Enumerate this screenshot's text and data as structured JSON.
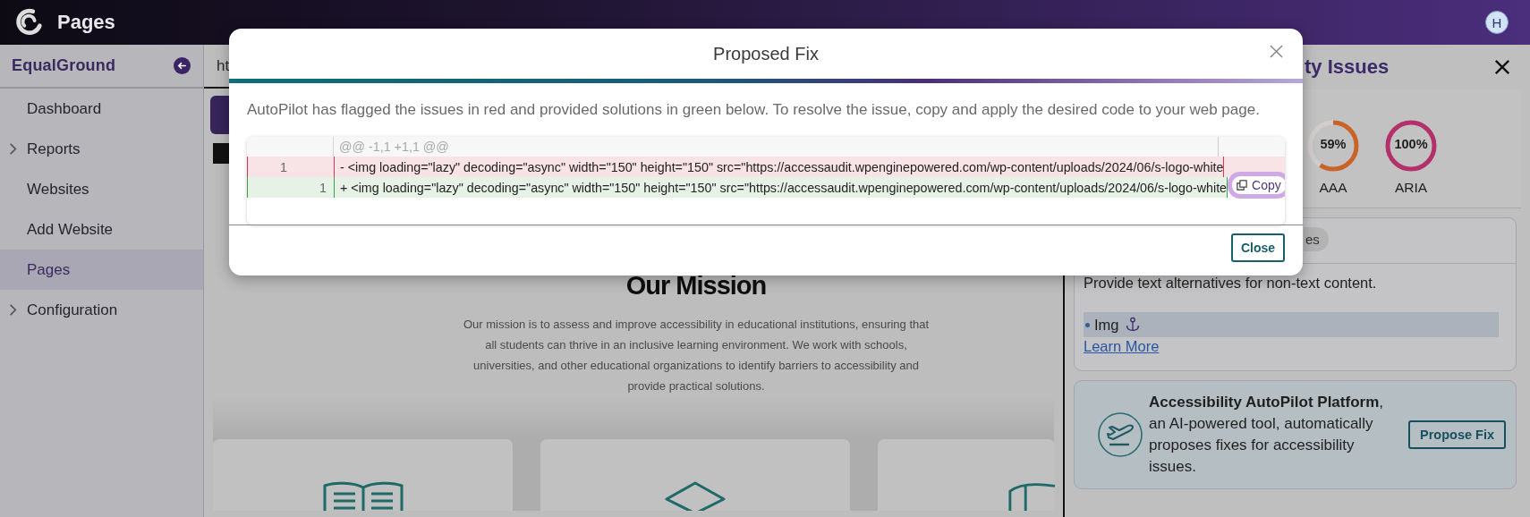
{
  "header": {
    "title": "Pages",
    "avatar": "H"
  },
  "sidebar": {
    "brand": "EqualGround",
    "items": [
      {
        "label": "Dashboard",
        "kind": "link",
        "selected": false
      },
      {
        "label": "Reports",
        "kind": "group",
        "expanded": false,
        "selected": false
      },
      {
        "label": "Websites",
        "kind": "link",
        "selected": false
      },
      {
        "label": "Add Website",
        "kind": "link",
        "selected": false
      },
      {
        "label": "Pages",
        "kind": "link",
        "selected": true
      },
      {
        "label": "Configuration",
        "kind": "group",
        "expanded": false,
        "selected": false
      }
    ]
  },
  "main": {
    "tab": "ht",
    "mission": {
      "heading": "Our Mission",
      "text": "Our mission is to assess and improve accessibility in educational institutions, ensuring that all students can thrive in an inclusive learning environment. We work with schools, universities, and other educational organizations to identify barriers to accessibility and provide practical solutions."
    }
  },
  "issues_panel": {
    "title": "ty Issues",
    "gauges": [
      {
        "value": "59%",
        "label": "AAA",
        "color": "#c8632a"
      },
      {
        "value": "100%",
        "label": "ARIA",
        "color": "#b3306b"
      }
    ],
    "tab": "es",
    "guideline": "Provide text alternatives for non-text content.",
    "elements": [
      {
        "label": "Img",
        "selected": true
      }
    ],
    "link": "Learn More",
    "autopilot": {
      "text": "**Accessibility AutoPilot Platform**, an AI-powered tool, automatically proposes fixes for accessibility issues.",
      "button": "Propose Fix"
    }
  },
  "modal": {
    "title": "Proposed Fix",
    "description": "AutoPilot has flagged the issues in red and provided solutions in green below. To resolve the issue, copy and apply the desired code to your web page.",
    "diff": {
      "hunk": "@@ -1,1 +1,1 @@",
      "lines": [
        {
          "kind": "removed",
          "old_line": "1",
          "text": "- <img loading=\"lazy\" decoding=\"async\" width=\"150\" height=\"150\" src=\"https://accessaudit.wpenginepowered.com/wp-content/uploads/2024/06/s-logo-white"
        },
        {
          "kind": "added",
          "new_line": "1",
          "text": "+ <img loading=\"lazy\" decoding=\"async\" width=\"150\" height=\"150\" src=\"https://accessaudit.wpenginepowered.com/wp-content/uploads/2024/06/s-logo-white",
          "copy": {
            "label": "Copy",
            "focused": true
          }
        }
      ]
    },
    "close": "Close"
  }
}
